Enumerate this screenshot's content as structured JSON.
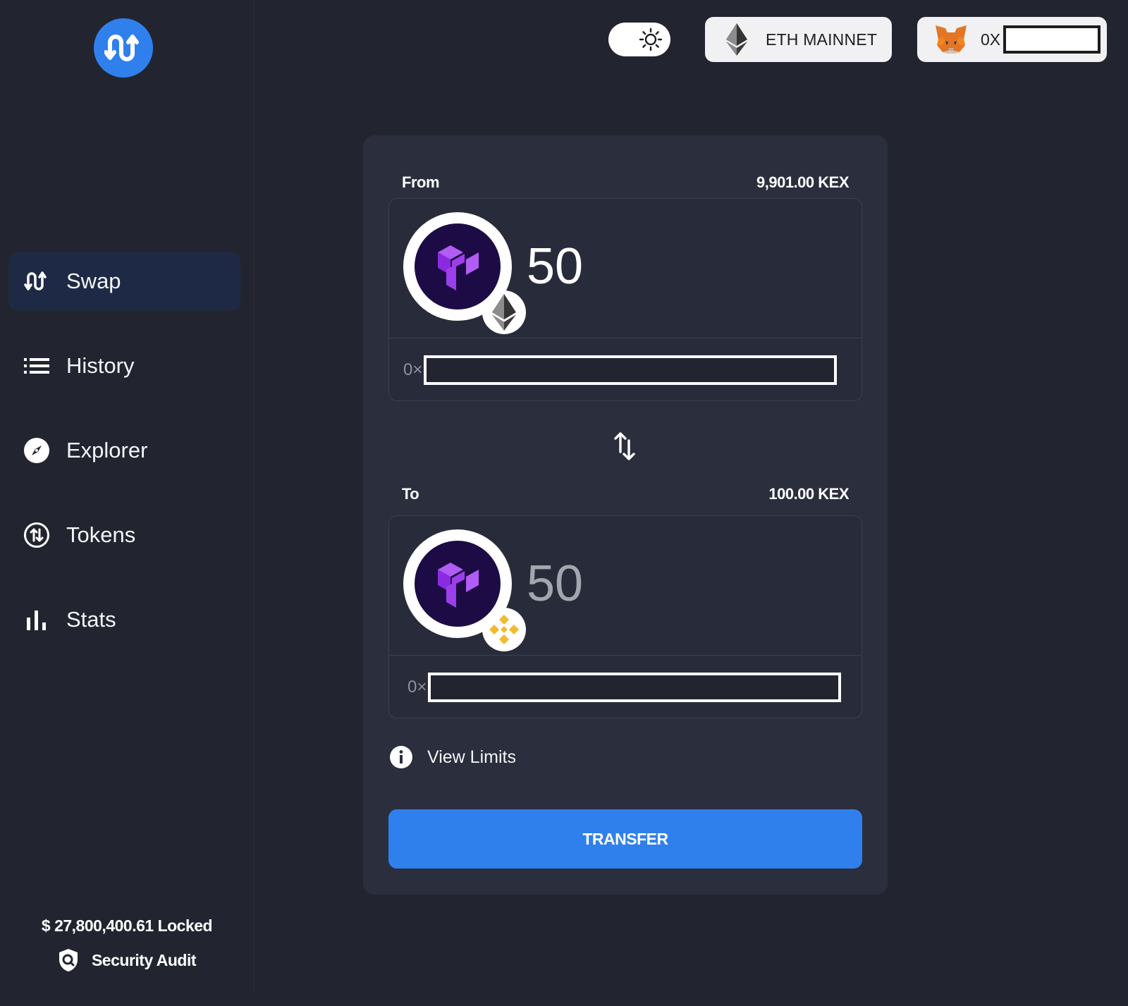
{
  "brand": {
    "accent": "#2f80ed",
    "background": "#22252f",
    "card": "#2a2e3d"
  },
  "sidebar": {
    "items": [
      {
        "label": "Swap",
        "icon": "swap-icon",
        "active": true
      },
      {
        "label": "History",
        "icon": "list-icon",
        "active": false
      },
      {
        "label": "Explorer",
        "icon": "compass-icon",
        "active": false
      },
      {
        "label": "Tokens",
        "icon": "token-icon",
        "active": false
      },
      {
        "label": "Stats",
        "icon": "bar-chart-icon",
        "active": false
      }
    ],
    "locked": "$ 27,800,400.61 Locked",
    "audit": "Security Audit"
  },
  "header": {
    "network": "ETH MAINNET",
    "wallet_prefix": "0X"
  },
  "swap": {
    "from": {
      "label": "From",
      "balance": "9,901.00 KEX",
      "amount": "50",
      "address_prefix": "0×",
      "chain_badge": "ethereum-icon"
    },
    "to": {
      "label": "To",
      "balance": "100.00 KEX",
      "amount": "50",
      "address_prefix": "0×",
      "chain_badge": "binance-icon"
    },
    "view_limits": "View Limits",
    "transfer": "TRANSFER"
  }
}
